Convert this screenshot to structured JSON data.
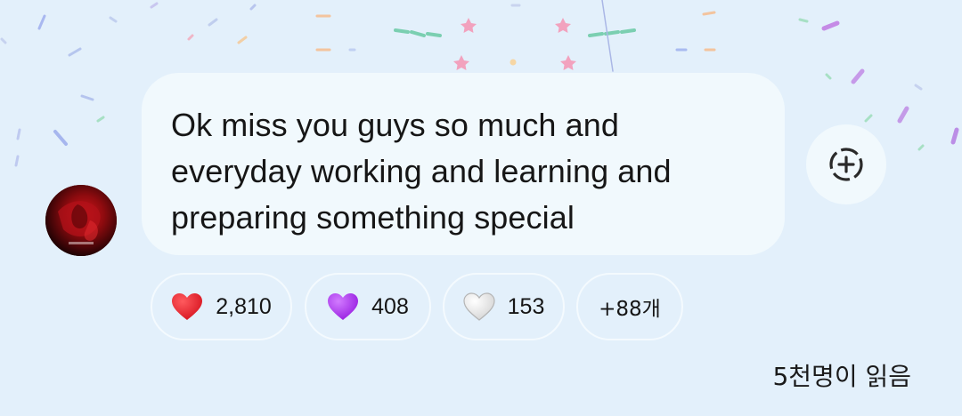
{
  "message": {
    "lines": [
      "Ok miss you guys so much and",
      "everyday working and learning and",
      "preparing something special"
    ]
  },
  "add_reaction": {
    "icon": "add-reaction-icon"
  },
  "reactions": [
    {
      "icon": "red-heart-icon",
      "count": "2,810",
      "color": "#e8202c"
    },
    {
      "icon": "purple-heart-icon",
      "count": "408",
      "color": "#a338e6"
    },
    {
      "icon": "white-heart-icon",
      "count": "153",
      "color": "#f4f4f4"
    },
    {
      "icon": "",
      "count": "+88개"
    }
  ],
  "read_status": "5천명이 읽음",
  "colors": {
    "background": "#e3f0fb",
    "bubble": "#f1f9fd"
  }
}
